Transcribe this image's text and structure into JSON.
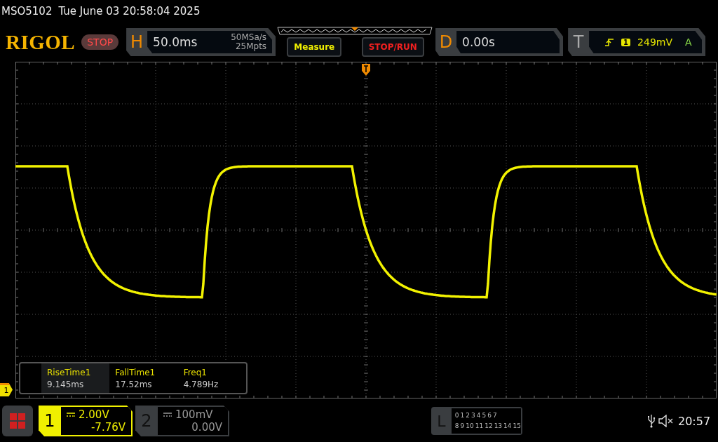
{
  "status_line": {
    "model": "MSO5102",
    "datetime": "Tue June 03 20:58:04 2025"
  },
  "brand": "RIGOL",
  "run_state": "STOP",
  "horizontal": {
    "label": "H",
    "timebase": "50.0ms",
    "sample_rate": "50MSa/s",
    "memory_depth": "25Mpts"
  },
  "buttons": [
    {
      "label": "Measure",
      "kind": "measure"
    },
    {
      "label": "STOP/RUN",
      "kind": "stoprun"
    }
  ],
  "delay": {
    "label": "D",
    "value": "0.00s"
  },
  "trigger": {
    "label": "T",
    "source": "1",
    "level": "249mV",
    "mode": "A"
  },
  "measurements": [
    {
      "name": "RiseTime1",
      "value": "9.145ms",
      "selected": true
    },
    {
      "name": "FallTime1",
      "value": "17.52ms",
      "selected": false
    },
    {
      "name": "Freq1",
      "value": "4.789Hz",
      "selected": false
    }
  ],
  "channel_marker": "1",
  "channels": [
    {
      "number": "1",
      "scale": "2.00V",
      "offset": "-7.76V",
      "on": true
    },
    {
      "number": "2",
      "scale": "100mV",
      "offset": "0.00V",
      "on": false
    }
  ],
  "logic": {
    "label": "L",
    "row_1": [
      "0",
      "1",
      "2",
      "3",
      "4",
      "5",
      "6",
      "7"
    ],
    "row_2": [
      "8",
      "9",
      "10",
      "11",
      "12",
      "13",
      "14",
      "15"
    ]
  },
  "clock": "20:57"
}
